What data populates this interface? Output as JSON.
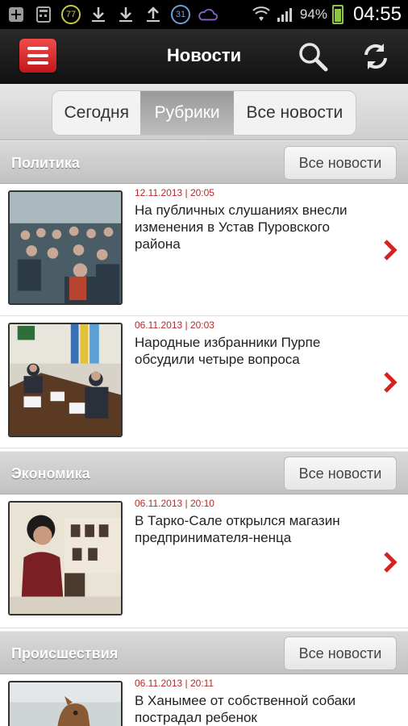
{
  "status": {
    "battery_percent": "94%",
    "time": "04:55",
    "badge_1": "77",
    "badge_2": "31"
  },
  "header": {
    "title": "Новости"
  },
  "tabs": [
    {
      "label": "Сегодня"
    },
    {
      "label": "Рубрики"
    },
    {
      "label": "Все новости"
    }
  ],
  "sections": [
    {
      "title": "Политика",
      "all_label": "Все новости",
      "items": [
        {
          "date": "12.11.2013 | 20:05",
          "headline": "На публичных слушаниях внесли изменения в Устав Пуровского района"
        },
        {
          "date": "06.11.2013 | 20:03",
          "headline": "Народные избранники Пурпе обсудили четыре вопроса"
        }
      ]
    },
    {
      "title": "Экономика",
      "all_label": "Все новости",
      "items": [
        {
          "date": "06.11.2013 | 20:10",
          "headline": "В Тарко-Сале открылся магазин предпринимателя-ненца"
        }
      ]
    },
    {
      "title": "Происшествия",
      "all_label": "Все новости",
      "items": [
        {
          "date": "06.11.2013 | 20:11",
          "headline": "В Ханымее от собственной собаки пострадал ребенок"
        }
      ]
    }
  ],
  "colors": {
    "accent_red": "#d82020",
    "date_red": "#b22a2a",
    "header_dark": "#1a1a1a"
  }
}
